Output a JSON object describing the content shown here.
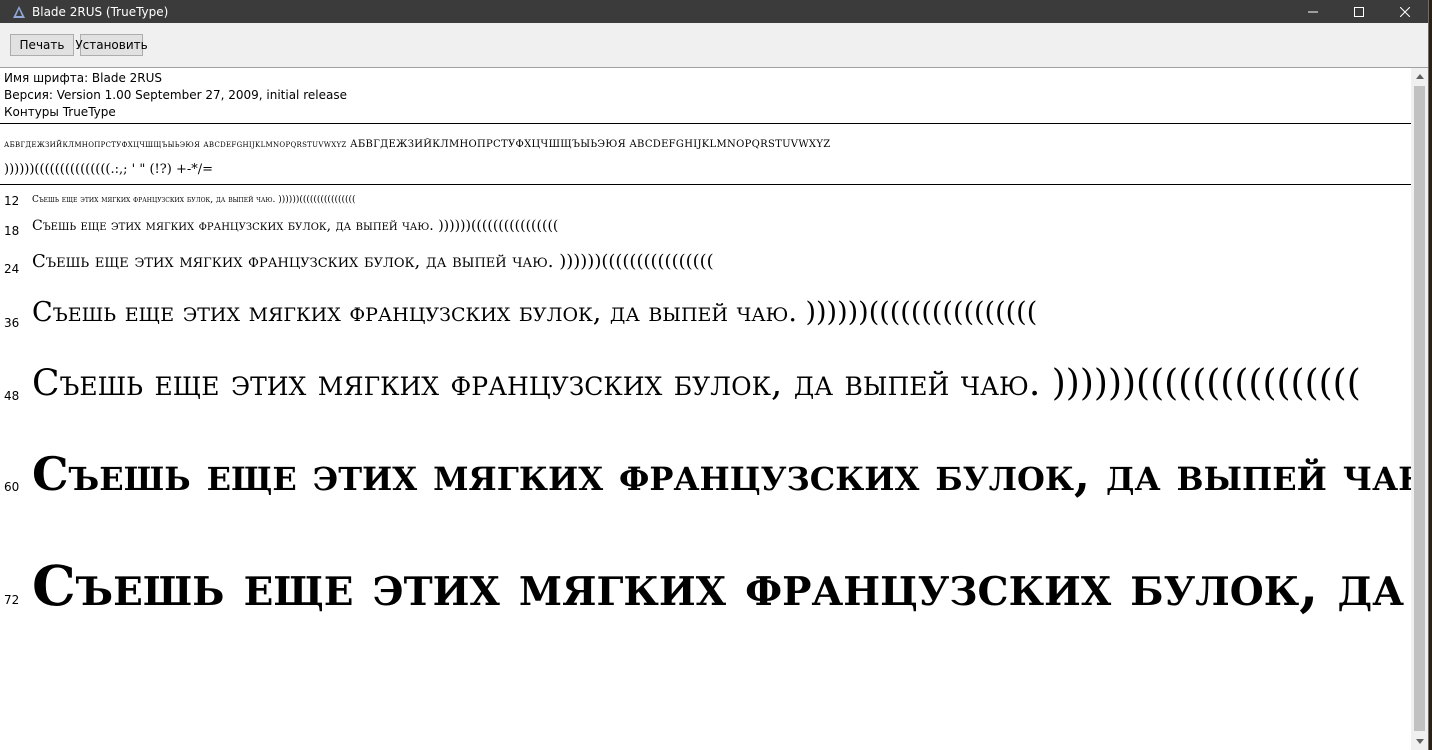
{
  "window": {
    "title": "Blade 2RUS (TrueType)"
  },
  "toolbar": {
    "print_label": "Печать",
    "install_label": "Установить"
  },
  "info": {
    "name_line": "Имя шрифта: Blade 2RUS",
    "version_line": "Версия: Version 1.00 September 27, 2009, initial release",
    "outline_line": "Контуры TrueType"
  },
  "charset": {
    "row1": "абвгдежзийклмнопрстуфхцчшщъыьэюя abcdefghijklmnopqrstuvwxyz АБВГДЕЖЗИЙКЛМНОПРСТУФХЦЧШЩЪЫЬЭЮЯ ABCDEFGHIJKLMNOPQRSTUVWXYZ",
    "row2": "))))))(((((((((((((((.:,; ' \" (!?) +-*/="
  },
  "samples": [
    {
      "size": "12",
      "text": "Съешь еще этих мягких французских булок, да выпей чаю. ))))))(((((((((((((((("
    },
    {
      "size": "18",
      "text": "Съешь еще этих мягких французских булок, да выпей чаю. ))))))(((((((((((((((("
    },
    {
      "size": "24",
      "text": "Съешь еще этих мягких французских булок, да выпей чаю. ))))))(((((((((((((((("
    },
    {
      "size": "36",
      "text": "Съешь еще этих мягких французских булок, да выпей чаю. ))))))(((((((((((((((("
    },
    {
      "size": "48",
      "text": "Съешь еще этих мягких французских булок, да выпей чаю. ))))))(((((((((((((((("
    },
    {
      "size": "60",
      "text": "Съешь еще этих мягких французских булок, да выпей чаю."
    },
    {
      "size": "72",
      "text": "Съешь еще этих мягких французских булок, да выпей чаю."
    }
  ]
}
